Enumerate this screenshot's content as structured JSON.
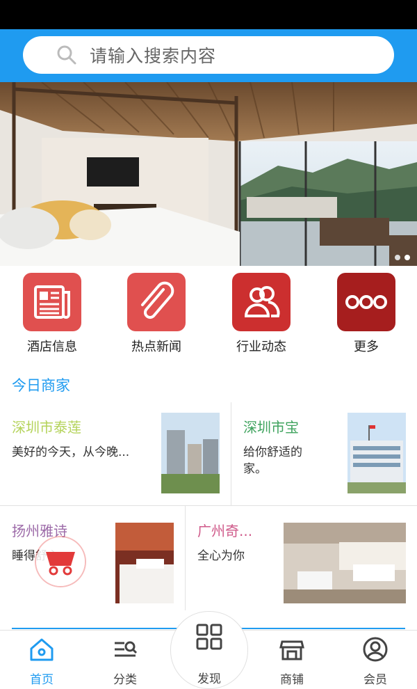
{
  "search": {
    "placeholder": "请输入搜索内容"
  },
  "quick_links": [
    {
      "label": "酒店信息",
      "icon": "newspaper-icon",
      "color": "#e0504f"
    },
    {
      "label": "热点新闻",
      "icon": "paperclip-icon",
      "color": "#e0504f"
    },
    {
      "label": "行业动态",
      "icon": "users-icon",
      "color": "#cc2f2f"
    },
    {
      "label": "更多",
      "icon": "more-dots-icon",
      "color": "#a61e1e"
    }
  ],
  "section_title": "今日商家",
  "merchants": [
    {
      "name": "深圳市泰莲",
      "desc": "美好的今天，从今晚...",
      "name_color": "#b4d35a"
    },
    {
      "name": "深圳市宝",
      "desc_line1": "给你舒适的",
      "desc_line2": "家。",
      "name_color": "#3fa35e"
    },
    {
      "name": "扬州雅诗",
      "desc": "睡得舒心。",
      "name_color": "#9c6aa8"
    },
    {
      "name": "广州奇...",
      "desc": "全心为你",
      "name_color": "#cf5a8a"
    }
  ],
  "tabs": [
    {
      "label": "首页",
      "icon": "home-icon",
      "active": true
    },
    {
      "label": "分类",
      "icon": "category-search-icon",
      "active": false
    },
    {
      "label": "发现",
      "icon": "grid-icon",
      "active": false
    },
    {
      "label": "商铺",
      "icon": "store-icon",
      "active": false
    },
    {
      "label": "会员",
      "icon": "user-icon",
      "active": false
    }
  ],
  "banner": {
    "dot_count": 2,
    "active_dot": 2
  }
}
